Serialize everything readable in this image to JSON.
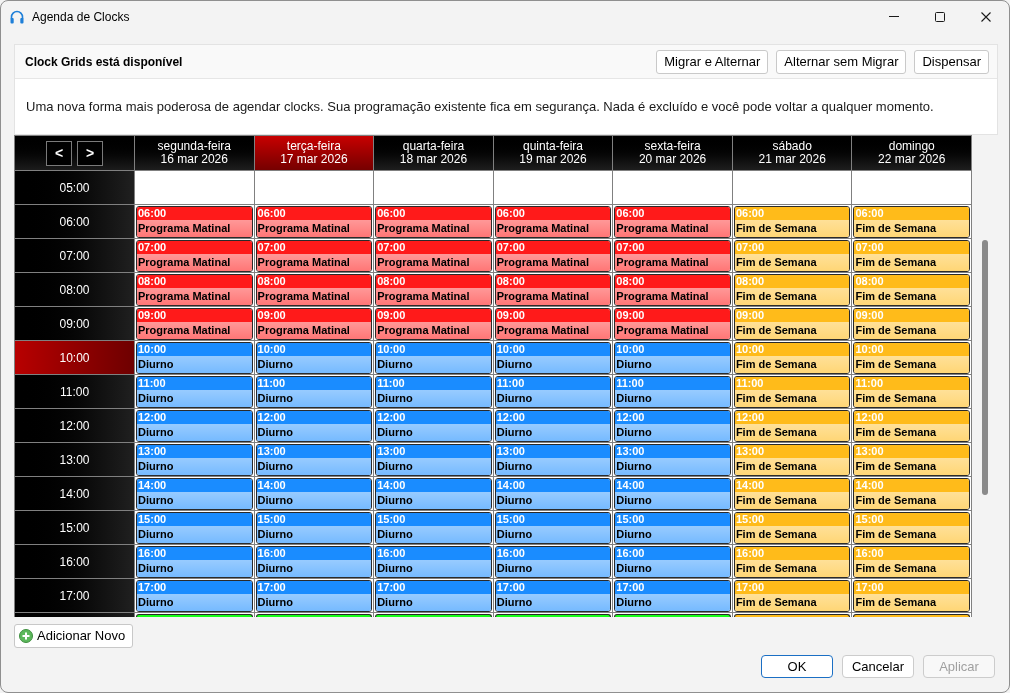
{
  "window": {
    "title": "Agenda de Clocks"
  },
  "banner": {
    "title": "Clock Grids está disponível",
    "buttons": [
      "Migrar e Alternar",
      "Alternar sem Migrar",
      "Dispensar"
    ],
    "message": "Uma nova forma mais poderosa de agendar clocks. Sua programação existente fica em segurança. Nada é excluído e você pode voltar a qualquer momento."
  },
  "calendar": {
    "nav": [
      "<",
      ">"
    ],
    "days": [
      {
        "weekday": "segunda-feira",
        "date": "16 mar 2026",
        "current": false
      },
      {
        "weekday": "terça-feira",
        "date": "17 mar 2026",
        "current": true
      },
      {
        "weekday": "quarta-feira",
        "date": "18 mar 2026",
        "current": false
      },
      {
        "weekday": "quinta-feira",
        "date": "19 mar 2026",
        "current": false
      },
      {
        "weekday": "sexta-feira",
        "date": "20 mar 2026",
        "current": false
      },
      {
        "weekday": "sábado",
        "date": "21 mar 2026",
        "current": false
      },
      {
        "weekday": "domingo",
        "date": "22 mar 2026",
        "current": false
      }
    ],
    "rows": [
      {
        "time": "05:00",
        "current": false
      },
      {
        "time": "06:00",
        "current": false,
        "events": [
          {
            "time": "06:00",
            "name": "Programa Matinal",
            "color": "#ff1a1a"
          },
          {
            "time": "06:00",
            "name": "Programa Matinal",
            "color": "#ff1a1a"
          },
          {
            "time": "06:00",
            "name": "Programa Matinal",
            "color": "#ff1a1a"
          },
          {
            "time": "06:00",
            "name": "Programa Matinal",
            "color": "#ff1a1a"
          },
          {
            "time": "06:00",
            "name": "Programa Matinal",
            "color": "#ff1a1a"
          },
          {
            "time": "06:00",
            "name": "Fim de Semana",
            "color": "#ffbb1a"
          },
          {
            "time": "06:00",
            "name": "Fim de Semana",
            "color": "#ffbb1a"
          }
        ]
      },
      {
        "time": "07:00",
        "current": false,
        "events": [
          {
            "time": "07:00",
            "name": "Programa Matinal",
            "color": "#ff1a1a"
          },
          {
            "time": "07:00",
            "name": "Programa Matinal",
            "color": "#ff1a1a"
          },
          {
            "time": "07:00",
            "name": "Programa Matinal",
            "color": "#ff1a1a"
          },
          {
            "time": "07:00",
            "name": "Programa Matinal",
            "color": "#ff1a1a"
          },
          {
            "time": "07:00",
            "name": "Programa Matinal",
            "color": "#ff1a1a"
          },
          {
            "time": "07:00",
            "name": "Fim de Semana",
            "color": "#ffbb1a"
          },
          {
            "time": "07:00",
            "name": "Fim de Semana",
            "color": "#ffbb1a"
          }
        ]
      },
      {
        "time": "08:00",
        "current": false,
        "events": [
          {
            "time": "08:00",
            "name": "Programa Matinal",
            "color": "#ff1a1a"
          },
          {
            "time": "08:00",
            "name": "Programa Matinal",
            "color": "#ff1a1a"
          },
          {
            "time": "08:00",
            "name": "Programa Matinal",
            "color": "#ff1a1a"
          },
          {
            "time": "08:00",
            "name": "Programa Matinal",
            "color": "#ff1a1a"
          },
          {
            "time": "08:00",
            "name": "Programa Matinal",
            "color": "#ff1a1a"
          },
          {
            "time": "08:00",
            "name": "Fim de Semana",
            "color": "#ffbb1a"
          },
          {
            "time": "08:00",
            "name": "Fim de Semana",
            "color": "#ffbb1a"
          }
        ]
      },
      {
        "time": "09:00",
        "current": false,
        "events": [
          {
            "time": "09:00",
            "name": "Programa Matinal",
            "color": "#ff1a1a"
          },
          {
            "time": "09:00",
            "name": "Programa Matinal",
            "color": "#ff1a1a"
          },
          {
            "time": "09:00",
            "name": "Programa Matinal",
            "color": "#ff1a1a"
          },
          {
            "time": "09:00",
            "name": "Programa Matinal",
            "color": "#ff1a1a"
          },
          {
            "time": "09:00",
            "name": "Programa Matinal",
            "color": "#ff1a1a"
          },
          {
            "time": "09:00",
            "name": "Fim de Semana",
            "color": "#ffbb1a"
          },
          {
            "time": "09:00",
            "name": "Fim de Semana",
            "color": "#ffbb1a"
          }
        ]
      },
      {
        "time": "10:00",
        "current": true,
        "events": [
          {
            "time": "10:00",
            "name": "Diurno",
            "color": "#1a8cff"
          },
          {
            "time": "10:00",
            "name": "Diurno",
            "color": "#1a8cff"
          },
          {
            "time": "10:00",
            "name": "Diurno",
            "color": "#1a8cff"
          },
          {
            "time": "10:00",
            "name": "Diurno",
            "color": "#1a8cff"
          },
          {
            "time": "10:00",
            "name": "Diurno",
            "color": "#1a8cff"
          },
          {
            "time": "10:00",
            "name": "Fim de Semana",
            "color": "#ffbb1a"
          },
          {
            "time": "10:00",
            "name": "Fim de Semana",
            "color": "#ffbb1a"
          }
        ]
      },
      {
        "time": "11:00",
        "current": false,
        "events": [
          {
            "time": "11:00",
            "name": "Diurno",
            "color": "#1a8cff"
          },
          {
            "time": "11:00",
            "name": "Diurno",
            "color": "#1a8cff"
          },
          {
            "time": "11:00",
            "name": "Diurno",
            "color": "#1a8cff"
          },
          {
            "time": "11:00",
            "name": "Diurno",
            "color": "#1a8cff"
          },
          {
            "time": "11:00",
            "name": "Diurno",
            "color": "#1a8cff"
          },
          {
            "time": "11:00",
            "name": "Fim de Semana",
            "color": "#ffbb1a"
          },
          {
            "time": "11:00",
            "name": "Fim de Semana",
            "color": "#ffbb1a"
          }
        ]
      },
      {
        "time": "12:00",
        "current": false,
        "events": [
          {
            "time": "12:00",
            "name": "Diurno",
            "color": "#1a8cff"
          },
          {
            "time": "12:00",
            "name": "Diurno",
            "color": "#1a8cff"
          },
          {
            "time": "12:00",
            "name": "Diurno",
            "color": "#1a8cff"
          },
          {
            "time": "12:00",
            "name": "Diurno",
            "color": "#1a8cff"
          },
          {
            "time": "12:00",
            "name": "Diurno",
            "color": "#1a8cff"
          },
          {
            "time": "12:00",
            "name": "Fim de Semana",
            "color": "#ffbb1a"
          },
          {
            "time": "12:00",
            "name": "Fim de Semana",
            "color": "#ffbb1a"
          }
        ]
      },
      {
        "time": "13:00",
        "current": false,
        "events": [
          {
            "time": "13:00",
            "name": "Diurno",
            "color": "#1a8cff"
          },
          {
            "time": "13:00",
            "name": "Diurno",
            "color": "#1a8cff"
          },
          {
            "time": "13:00",
            "name": "Diurno",
            "color": "#1a8cff"
          },
          {
            "time": "13:00",
            "name": "Diurno",
            "color": "#1a8cff"
          },
          {
            "time": "13:00",
            "name": "Diurno",
            "color": "#1a8cff"
          },
          {
            "time": "13:00",
            "name": "Fim de Semana",
            "color": "#ffbb1a"
          },
          {
            "time": "13:00",
            "name": "Fim de Semana",
            "color": "#ffbb1a"
          }
        ]
      },
      {
        "time": "14:00",
        "current": false,
        "events": [
          {
            "time": "14:00",
            "name": "Diurno",
            "color": "#1a8cff"
          },
          {
            "time": "14:00",
            "name": "Diurno",
            "color": "#1a8cff"
          },
          {
            "time": "14:00",
            "name": "Diurno",
            "color": "#1a8cff"
          },
          {
            "time": "14:00",
            "name": "Diurno",
            "color": "#1a8cff"
          },
          {
            "time": "14:00",
            "name": "Diurno",
            "color": "#1a8cff"
          },
          {
            "time": "14:00",
            "name": "Fim de Semana",
            "color": "#ffbb1a"
          },
          {
            "time": "14:00",
            "name": "Fim de Semana",
            "color": "#ffbb1a"
          }
        ]
      },
      {
        "time": "15:00",
        "current": false,
        "events": [
          {
            "time": "15:00",
            "name": "Diurno",
            "color": "#1a8cff"
          },
          {
            "time": "15:00",
            "name": "Diurno",
            "color": "#1a8cff"
          },
          {
            "time": "15:00",
            "name": "Diurno",
            "color": "#1a8cff"
          },
          {
            "time": "15:00",
            "name": "Diurno",
            "color": "#1a8cff"
          },
          {
            "time": "15:00",
            "name": "Diurno",
            "color": "#1a8cff"
          },
          {
            "time": "15:00",
            "name": "Fim de Semana",
            "color": "#ffbb1a"
          },
          {
            "time": "15:00",
            "name": "Fim de Semana",
            "color": "#ffbb1a"
          }
        ]
      },
      {
        "time": "16:00",
        "current": false,
        "events": [
          {
            "time": "16:00",
            "name": "Diurno",
            "color": "#1a8cff"
          },
          {
            "time": "16:00",
            "name": "Diurno",
            "color": "#1a8cff"
          },
          {
            "time": "16:00",
            "name": "Diurno",
            "color": "#1a8cff"
          },
          {
            "time": "16:00",
            "name": "Diurno",
            "color": "#1a8cff"
          },
          {
            "time": "16:00",
            "name": "Diurno",
            "color": "#1a8cff"
          },
          {
            "time": "16:00",
            "name": "Fim de Semana",
            "color": "#ffbb1a"
          },
          {
            "time": "16:00",
            "name": "Fim de Semana",
            "color": "#ffbb1a"
          }
        ]
      },
      {
        "time": "17:00",
        "current": false,
        "events": [
          {
            "time": "17:00",
            "name": "Diurno",
            "color": "#1a8cff"
          },
          {
            "time": "17:00",
            "name": "Diurno",
            "color": "#1a8cff"
          },
          {
            "time": "17:00",
            "name": "Diurno",
            "color": "#1a8cff"
          },
          {
            "time": "17:00",
            "name": "Diurno",
            "color": "#1a8cff"
          },
          {
            "time": "17:00",
            "name": "Diurno",
            "color": "#1a8cff"
          },
          {
            "time": "17:00",
            "name": "Fim de Semana",
            "color": "#ffbb1a"
          },
          {
            "time": "17:00",
            "name": "Fim de Semana",
            "color": "#ffbb1a"
          }
        ]
      },
      {
        "events": [
          {
            "color": "#1aff1a"
          },
          {
            "color": "#1aff1a"
          },
          {
            "color": "#1aff1a"
          },
          {
            "color": "#1aff1a"
          },
          {
            "color": "#1aff1a"
          },
          {
            "color": "#ffbb1a"
          },
          {
            "color": "#ffbb1a"
          }
        ]
      }
    ]
  },
  "add_button": {
    "label": "Adicionar Novo"
  },
  "footer": {
    "buttons": [
      {
        "label": "OK",
        "default": true,
        "disabled": false
      },
      {
        "label": "Cancelar",
        "default": false,
        "disabled": false
      },
      {
        "label": "Aplicar",
        "default": false,
        "disabled": true
      }
    ]
  }
}
